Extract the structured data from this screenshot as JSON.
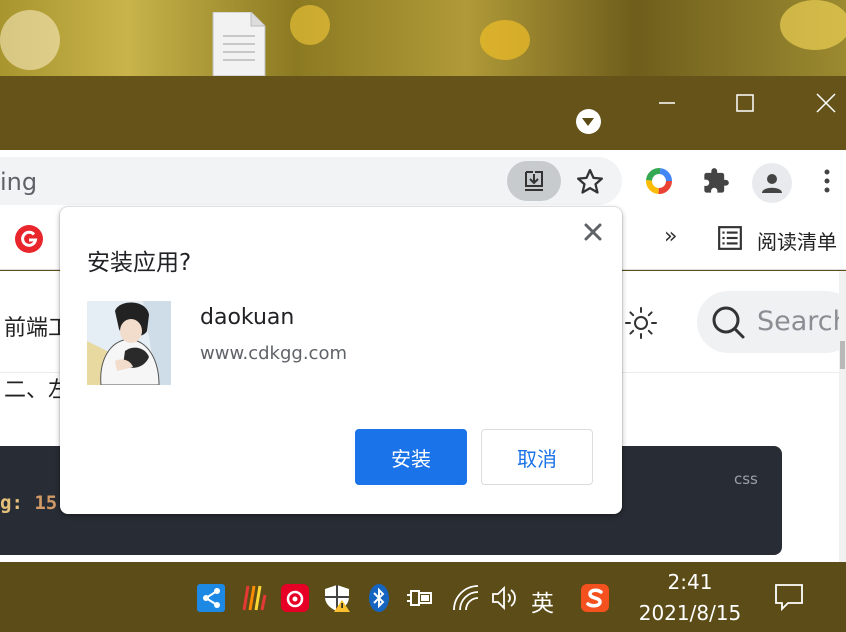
{
  "browser": {
    "address_text": "ing",
    "bookmarks": {
      "overflow_label": "»",
      "reading_list_label": "阅读清单"
    }
  },
  "page": {
    "nav_text": "前端工",
    "heading_text": "二、左",
    "search_placeholder": "Search",
    "code": {
      "lang": "css",
      "prop": "g:",
      "value": "15",
      "rest": "   "
    }
  },
  "dialog": {
    "title": "安装应用?",
    "app_name": "daokuan",
    "app_url": "www.cdkgg.com",
    "install_label": "安装",
    "cancel_label": "取消"
  },
  "taskbar": {
    "ime": "英",
    "time": "2:41",
    "date": "2021/8/15"
  },
  "colors": {
    "accent": "#1a73e8",
    "titlebar": "#66531a",
    "code_bg": "#282c34"
  }
}
